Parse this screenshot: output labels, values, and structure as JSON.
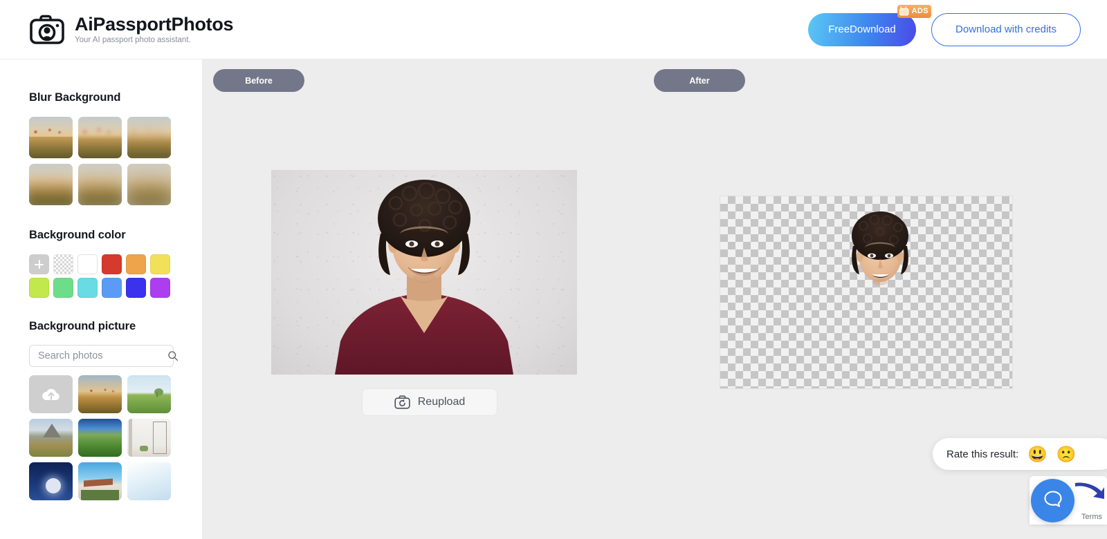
{
  "header": {
    "brand_title": "AiPassportPhotos",
    "brand_subtitle": "Your AI passport photo assistant.",
    "brand_icon": "camera-logo-icon",
    "free_download_label": "FreeDownload",
    "ads_badge_label": "ADS",
    "ads_badge_icon": "tv-icon",
    "download_credits_label": "Download with credits",
    "accent_blue": "#2f6fed",
    "ads_orange": "#ef8b3c"
  },
  "sidebar": {
    "blur_background": {
      "title": "Blur Background",
      "thumbs": [
        {
          "name": "blur-level-0",
          "blur": 0
        },
        {
          "name": "blur-level-1",
          "blur": 2.2
        },
        {
          "name": "blur-level-2",
          "blur": 4.5
        },
        {
          "name": "blur-level-3",
          "blur": 7
        },
        {
          "name": "blur-level-4",
          "blur": 9.5
        },
        {
          "name": "blur-level-5",
          "blur": 12
        }
      ]
    },
    "background_color": {
      "title": "Background color",
      "add_swatch_icon": "plus-icon",
      "transparent_swatch": "transparent",
      "colors": [
        "#ffffff",
        "#d6392d",
        "#eda44a",
        "#f2e05a",
        "#c2e84c",
        "#6ddd8a",
        "#68dbe3",
        "#5a9bf6",
        "#3a32ec",
        "#ac3ef0"
      ]
    },
    "background_picture": {
      "title": "Background picture",
      "search_placeholder": "Search photos",
      "search_value": "",
      "search_icon": "search-icon",
      "upload_tile_icon": "cloud-upload-icon",
      "thumbs": [
        "upload",
        "desert-sunrise-balloons",
        "lone-tree-green-field",
        "rocky-mountain-meadow",
        "alpine-green-valley",
        "white-room-plant-shelf",
        "full-moon-night-sky",
        "village-rooftop-blue-sky",
        "soft-blue-gradient"
      ]
    }
  },
  "main": {
    "before_label": "Before",
    "after_label": "After",
    "reupload_label": "Reupload",
    "reupload_icon": "camera-refresh-icon",
    "before_image_alt": "young man with curly hair in maroon v-neck on gray wall",
    "after_image_alt": "cut-out face on transparent checkerboard",
    "canvas_background": "#ededed"
  },
  "rating": {
    "label": "Rate this result:",
    "positive_emoji": "😃",
    "negative_emoji": "🙁"
  },
  "widgets": {
    "terms_label": "Terms",
    "help_icon": "chat-bubble-icon",
    "help_color": "#3a85e8"
  }
}
